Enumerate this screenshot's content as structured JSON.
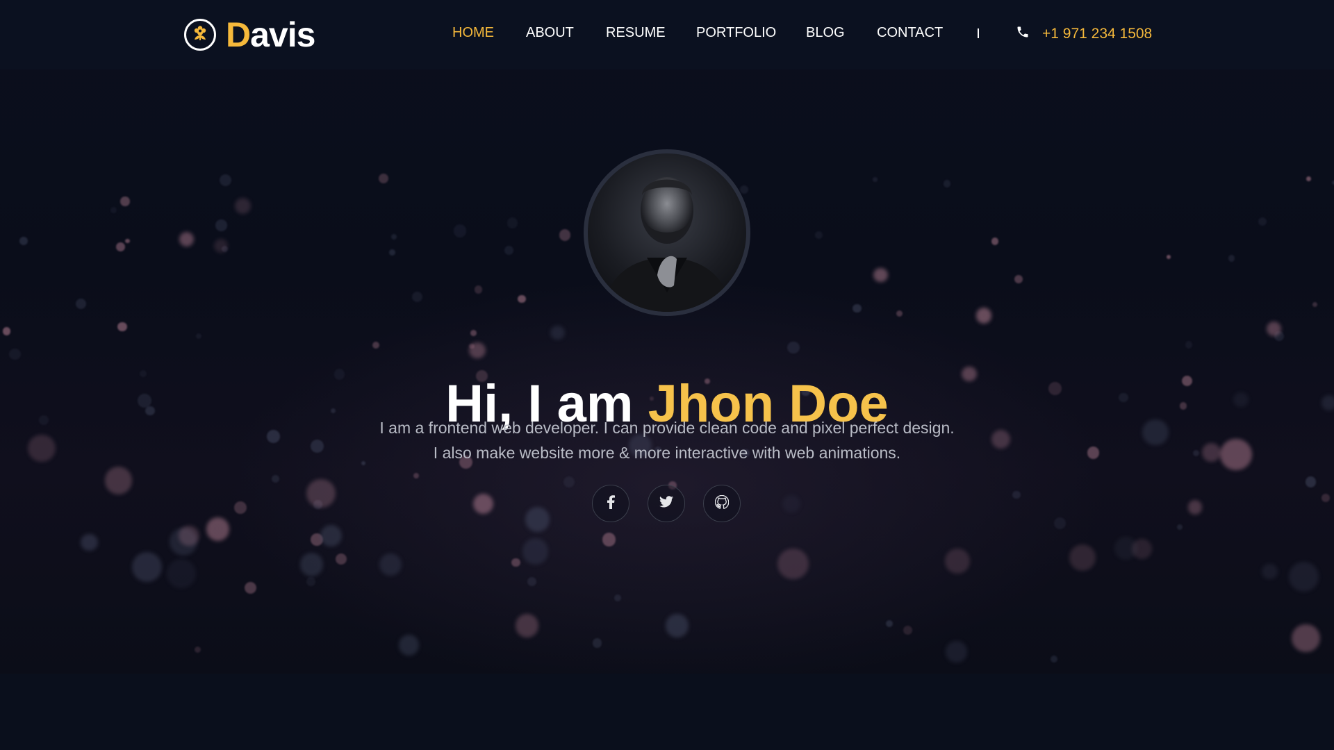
{
  "brand": {
    "first_letter": "D",
    "rest": "avis",
    "accent_color": "#f6b93b",
    "icon": "flower-logo-icon"
  },
  "nav": {
    "items": [
      {
        "label": "HOME",
        "active": true
      },
      {
        "label": "ABOUT",
        "active": false
      },
      {
        "label": "RESUME",
        "active": false
      },
      {
        "label": "PORTFOLIO",
        "active": false
      },
      {
        "label": "BLOG",
        "active": false
      },
      {
        "label": "CONTACT",
        "active": false
      }
    ],
    "separator": "|",
    "phone_icon": "phone-icon",
    "phone": "+1 971 234 1508"
  },
  "hero": {
    "avatar_icon": "profile-photo",
    "greeting": "Hi, I am ",
    "name": "Jhon Doe",
    "description_line1": "I am a frontend web developer. I can provide clean code and pixel perfect design.",
    "description_line2": "I also make website more & more interactive with web animations.",
    "socials": [
      {
        "icon": "facebook-icon"
      },
      {
        "icon": "twitter-icon"
      },
      {
        "icon": "github-icon"
      }
    ]
  },
  "colors": {
    "background": "#0a0f1c",
    "header": "#0b1120",
    "accent": "#f6b93b",
    "text": "#ffffff",
    "muted": "#b9bcc6"
  }
}
